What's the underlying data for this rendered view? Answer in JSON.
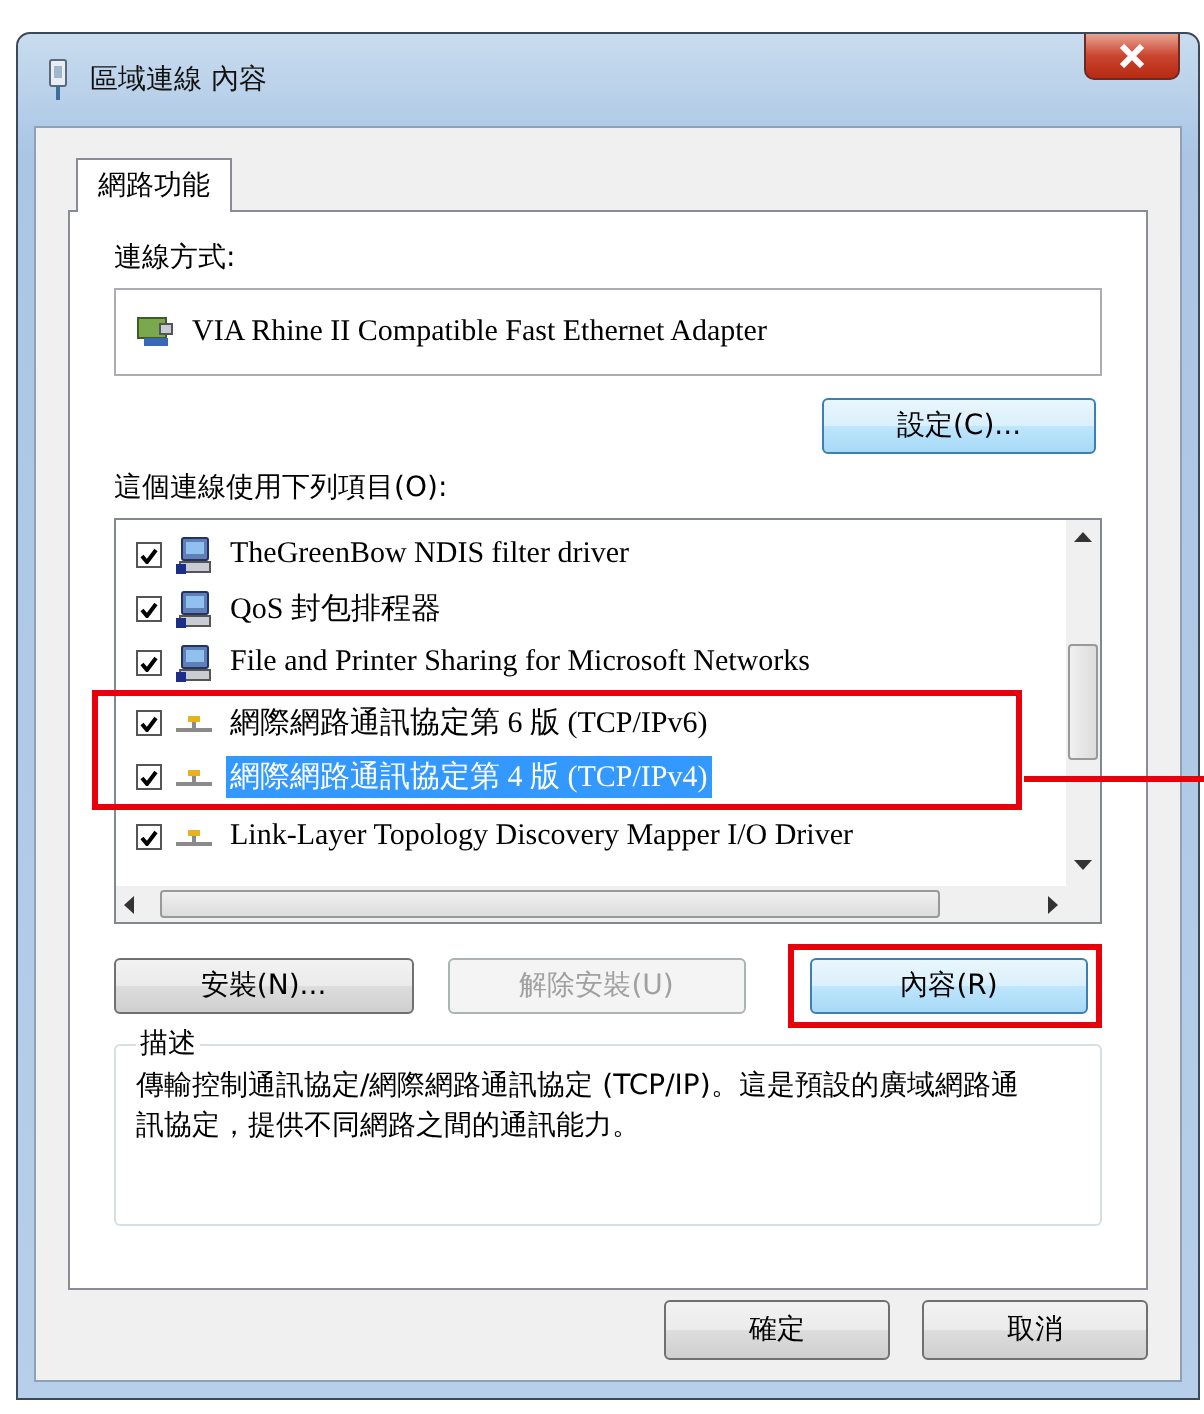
{
  "window": {
    "title": "區域連線 內容"
  },
  "tabs": [
    {
      "label": "網路功能",
      "selected": true
    }
  ],
  "connect_using": {
    "label": "連線方式:",
    "adapter": "VIA Rhine II Compatible Fast Ethernet Adapter",
    "configure_button": "設定(C)..."
  },
  "items": {
    "label": "這個連線使用下列項目(O):",
    "rows": [
      {
        "text": "TheGreenBow NDIS filter driver",
        "checked": true,
        "selected": false,
        "highlighted": false,
        "kind": "client"
      },
      {
        "text": "QoS 封包排程器",
        "checked": true,
        "selected": false,
        "highlighted": false,
        "kind": "client"
      },
      {
        "text": "File and Printer Sharing for Microsoft Networks",
        "checked": true,
        "selected": false,
        "highlighted": false,
        "kind": "client"
      },
      {
        "text": "網際網路通訊協定第 6 版 (TCP/IPv6)",
        "checked": true,
        "selected": false,
        "highlighted": true,
        "kind": "protocol"
      },
      {
        "text": "網際網路通訊協定第 4 版 (TCP/IPv4)",
        "checked": true,
        "selected": true,
        "highlighted": true,
        "kind": "protocol"
      },
      {
        "text": "Link-Layer Topology Discovery Mapper I/O Driver",
        "checked": true,
        "selected": false,
        "highlighted": false,
        "kind": "protocol"
      }
    ]
  },
  "actions": [
    {
      "label": "安裝(N)...",
      "disabled": false,
      "highlighted": false
    },
    {
      "label": "解除安裝(U)",
      "disabled": true,
      "highlighted": false
    },
    {
      "label": "內容(R)",
      "disabled": false,
      "highlighted": true
    }
  ],
  "description": {
    "label": "描述",
    "text": "傳輸控制通訊協定/網際網路通訊協定 (TCP/IP)。這是預設的廣域網路通訊協定，提供不同網路之間的通訊能力。"
  },
  "buttons": [
    {
      "label": "確定"
    },
    {
      "label": "取消"
    }
  ]
}
